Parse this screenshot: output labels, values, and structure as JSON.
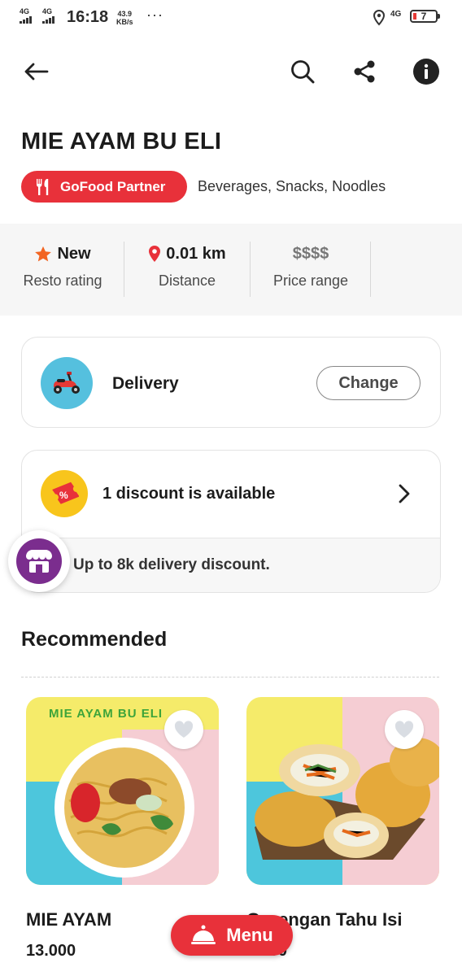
{
  "status_bar": {
    "net1": "4G",
    "net2": "4G",
    "time": "16:18",
    "speed_value": "43.9",
    "speed_unit": "KB/s",
    "more": "···",
    "net_right": "4G",
    "battery": "7"
  },
  "header": {
    "back_icon": "arrow-left-icon",
    "search_icon": "search-icon",
    "share_icon": "share-icon",
    "info_icon": "info-icon"
  },
  "restaurant": {
    "name": "MIE AYAM BU ELI",
    "badge_label": "GoFood Partner",
    "cuisines": "Beverages, Snacks, Noodles",
    "accent_color": "#e8313a"
  },
  "stats": [
    {
      "value": "New",
      "label": "Resto rating",
      "icon": "star-icon"
    },
    {
      "value": "0.01 km",
      "label": "Distance",
      "icon": "location-pin-icon"
    },
    {
      "value": "$$$$",
      "label": "Price range",
      "icon": ""
    }
  ],
  "delivery": {
    "label": "Delivery",
    "change_label": "Change",
    "icon": "scooter-icon"
  },
  "discount": {
    "title": "1 discount is available",
    "detail": "Up to 8k delivery discount.",
    "icon": "discount-ticket-icon"
  },
  "recommended": {
    "title": "Recommended",
    "items": [
      {
        "name": "MIE AYAM",
        "price": "13.000",
        "image_caption": "MIE AYAM BU ELI"
      },
      {
        "name": "Gorengan Tahu Isi",
        "price": "5.000"
      }
    ]
  },
  "menu_button": {
    "label": "Menu",
    "icon": "cloche-icon"
  }
}
